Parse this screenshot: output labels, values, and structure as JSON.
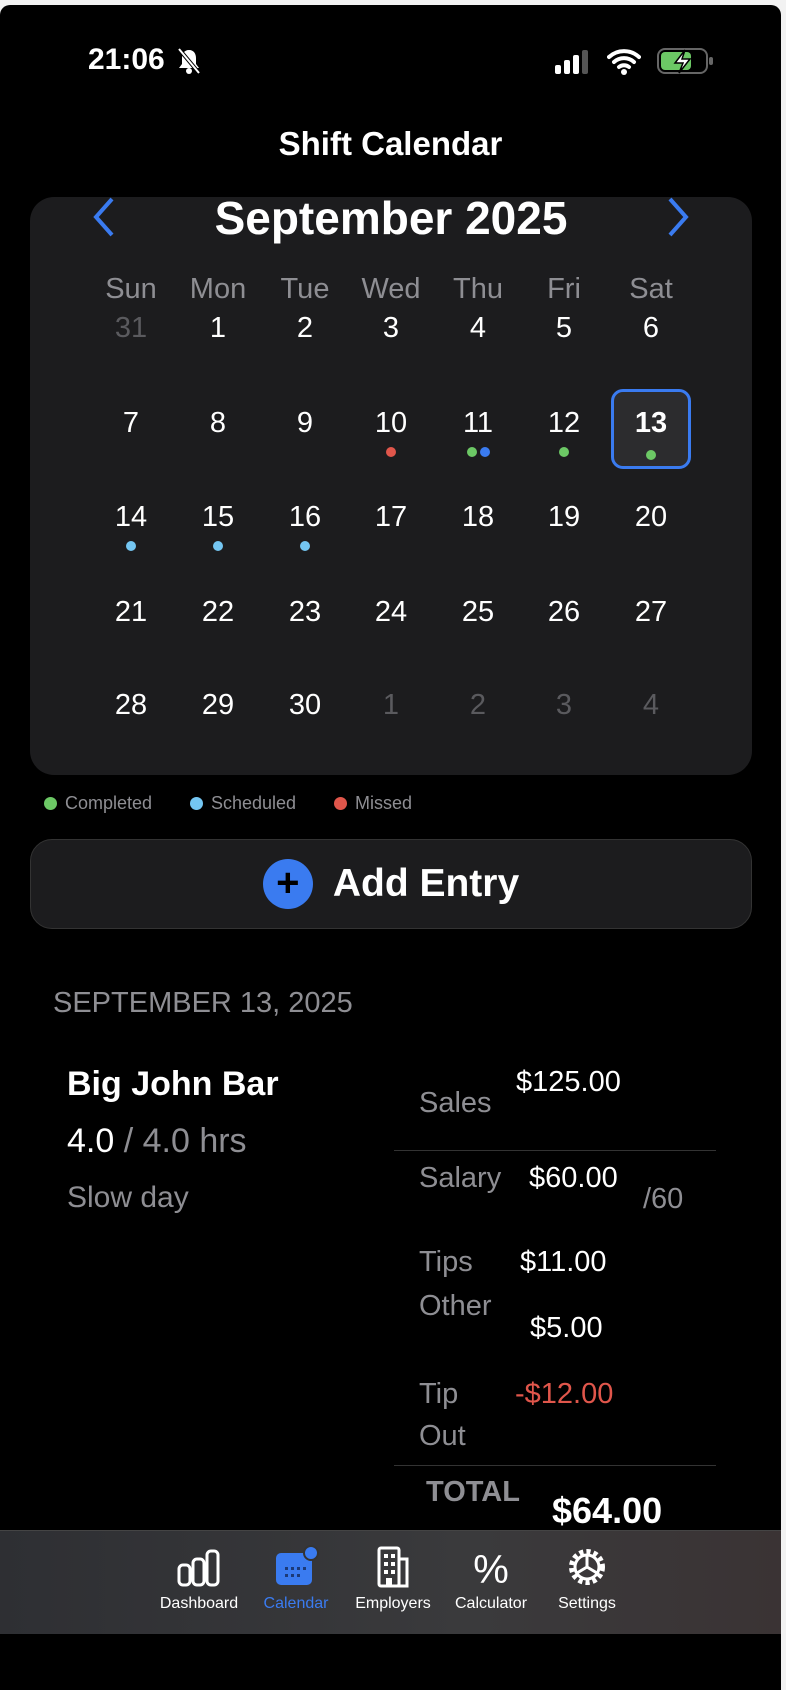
{
  "status": {
    "time": "21:06"
  },
  "header": {
    "title": "Shift Calendar"
  },
  "calendar": {
    "month": "September 2025",
    "weekdays": [
      "Sun",
      "Mon",
      "Tue",
      "Wed",
      "Thu",
      "Fri",
      "Sat"
    ],
    "days": [
      {
        "d": "31",
        "muted": true
      },
      {
        "d": "1"
      },
      {
        "d": "2"
      },
      {
        "d": "3"
      },
      {
        "d": "4"
      },
      {
        "d": "5"
      },
      {
        "d": "6"
      },
      {
        "d": "7"
      },
      {
        "d": "8"
      },
      {
        "d": "9"
      },
      {
        "d": "10",
        "dots": [
          "missed"
        ]
      },
      {
        "d": "11",
        "dots": [
          "completed",
          "other"
        ]
      },
      {
        "d": "12",
        "dots": [
          "completed"
        ]
      },
      {
        "d": "13",
        "selected": true,
        "dots": [
          "completed"
        ]
      },
      {
        "d": "14",
        "dots": [
          "scheduled"
        ]
      },
      {
        "d": "15",
        "dots": [
          "scheduled"
        ]
      },
      {
        "d": "16",
        "dots": [
          "scheduled"
        ]
      },
      {
        "d": "17"
      },
      {
        "d": "18"
      },
      {
        "d": "19"
      },
      {
        "d": "20"
      },
      {
        "d": "21"
      },
      {
        "d": "22"
      },
      {
        "d": "23"
      },
      {
        "d": "24"
      },
      {
        "d": "25"
      },
      {
        "d": "26"
      },
      {
        "d": "27"
      },
      {
        "d": "28"
      },
      {
        "d": "29"
      },
      {
        "d": "30"
      },
      {
        "d": "1",
        "muted": true
      },
      {
        "d": "2",
        "muted": true
      },
      {
        "d": "3",
        "muted": true
      },
      {
        "d": "4",
        "muted": true
      }
    ]
  },
  "legend": {
    "completed": "Completed",
    "scheduled": "Scheduled",
    "missed": "Missed"
  },
  "colors": {
    "completed": "#6cc865",
    "scheduled": "#74c6f2",
    "missed": "#e0564b",
    "other": "#3a7bf0",
    "accent": "#3a7bf0"
  },
  "add_entry": {
    "label": "Add Entry"
  },
  "entry": {
    "date": "SEPTEMBER 13, 2025",
    "employer": "Big John Bar",
    "hours_worked": "4.0",
    "hours_scheduled": "/ 4.0 hrs",
    "note": "Slow day",
    "sales_label": "Sales",
    "sales": "$125.00",
    "salary_label": "Salary",
    "salary": "$60.00",
    "salary_rate": "/60",
    "tips_label": "Tips",
    "tips": "$11.00",
    "other_label": "Other",
    "other": "$5.00",
    "tipout_label": "Tip Out",
    "tipout": "-$12.00",
    "total_label": "TOTAL",
    "total": "$64.00"
  },
  "tabs": [
    {
      "label": "Dashboard"
    },
    {
      "label": "Calendar",
      "active": true
    },
    {
      "label": "Employers"
    },
    {
      "label": "Calculator"
    },
    {
      "label": "Settings"
    }
  ]
}
